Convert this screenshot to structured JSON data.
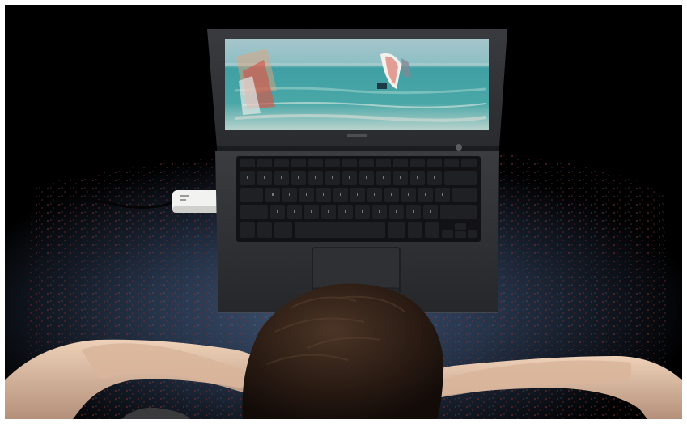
{
  "scene": {
    "subject": "person-watching-laptop",
    "screen_content": "windsurfing-video",
    "accessory": "usb-tv-tuner-stick",
    "colors": {
      "background": "#000000",
      "carpet_base": "#1a2230",
      "carpet_light": "#3f5272",
      "carpet_fleck_red": "#7a2f2f",
      "laptop_body": "#2a2b2e",
      "laptop_edge": "#45474b",
      "keyboard": "#121214",
      "key": "#1f2023",
      "key_label": "#bfc3c9",
      "screen_sky": "#9fc2c8",
      "screen_sea": "#3d9ea0",
      "screen_sea_light": "#86c6c2",
      "screen_sand": "#c7d6d0",
      "sail_white": "#f1f1ee",
      "sail_red": "#d5584a",
      "sail_orange": "#e3a37a",
      "skin": "#e4c3a8",
      "skin_shadow": "#b4907a",
      "hair": "#2a1b13",
      "hair_highlight": "#4b3526",
      "shirt": "#3a3a3c",
      "tuner_body": "#f2f2f0",
      "cable": "#0a0a0a"
    }
  }
}
